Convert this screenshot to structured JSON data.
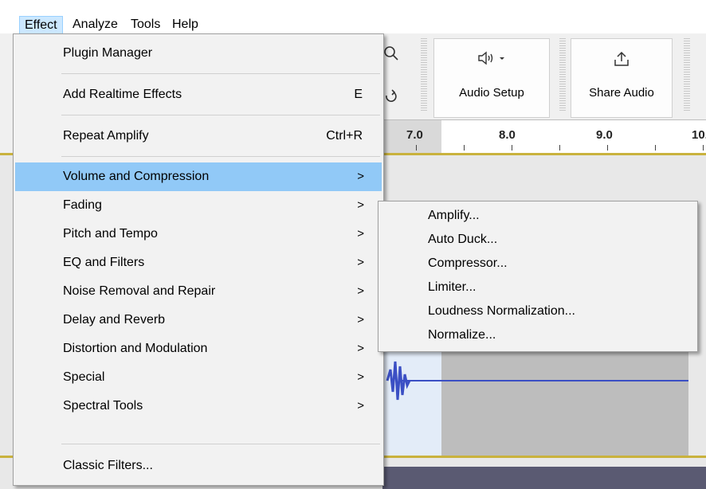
{
  "menubar": {
    "items": [
      {
        "label": "Effect",
        "active": true
      },
      {
        "label": "Analyze"
      },
      {
        "label": "Tools"
      },
      {
        "label": "Help"
      }
    ]
  },
  "toolbar": {
    "audio_setup_label": "Audio Setup",
    "share_audio_label": "Share Audio",
    "audio_setup_icon": "speaker-icon",
    "share_audio_icon": "share-icon"
  },
  "timeline": {
    "ticks": [
      "7.0",
      "8.0",
      "9.0",
      "10."
    ]
  },
  "effect_menu": {
    "plugin_manager": "Plugin Manager",
    "add_realtime": "Add Realtime Effects",
    "add_realtime_shortcut": "E",
    "repeat_amplify": "Repeat Amplify",
    "repeat_amplify_shortcut": "Ctrl+R",
    "submenus": [
      "Volume and Compression",
      "Fading",
      "Pitch and Tempo",
      "EQ and Filters",
      "Noise Removal and Repair",
      "Delay and Reverb",
      "Distortion and Modulation",
      "Special",
      "Spectral Tools"
    ],
    "classic_filters": "Classic Filters..."
  },
  "volume_submenu": {
    "items": [
      "Amplify...",
      "Auto Duck...",
      "Compressor...",
      "Limiter...",
      "Loudness Normalization...",
      "Normalize..."
    ]
  },
  "colors": {
    "highlight": "#91c9f7",
    "menubar_active": "#cce8ff",
    "waveform": "#3b4fc4"
  }
}
